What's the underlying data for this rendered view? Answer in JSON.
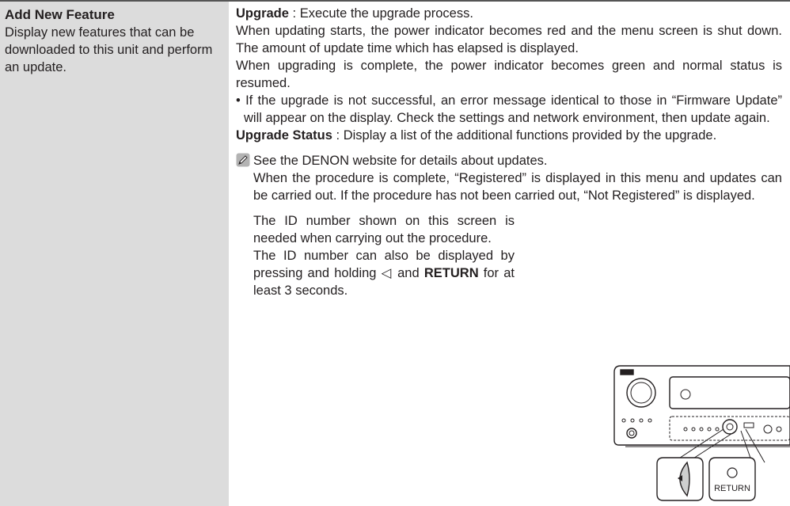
{
  "left": {
    "title": "Add New Feature",
    "description": "Display new features that can be downloaded to this unit and perform an update."
  },
  "right": {
    "upgrade_label": "Upgrade",
    "upgrade_text": " : Execute the upgrade process.",
    "para1": "When updating starts, the power indicator becomes red and the menu screen is shut down. The amount of update time which has elapsed is displayed.",
    "para2": "When upgrading is complete, the power indicator becomes green and normal status is resumed.",
    "bullet": "• If the upgrade is not successful, an error message identical to those in “Firmware Update” will appear on the display. Check the settings and network environment, then update again.",
    "status_label": "Upgrade Status",
    "status_text": " : Display a list of the additional functions provided by the upgrade.",
    "note1": "See the DENON website for details about updates.",
    "note2": "When the procedure is complete, “Registered” is displayed in this menu and updates can be carried out. If the procedure has not been carried out, “Not Registered” is displayed.",
    "id1": "The ID number shown on this screen is needed when carrying out the procedure.",
    "id2_pre": "The ID number can also be displayed by pressing and holding ",
    "id2_arrow": "◁",
    "id2_mid": " and ",
    "id2_return": "RETURN",
    "id2_post": " for at least 3 seconds."
  },
  "illustration": {
    "return_label": "RETURN"
  }
}
